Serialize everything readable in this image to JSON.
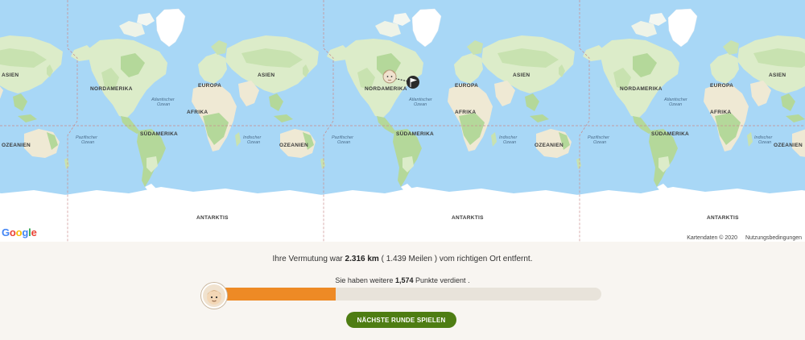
{
  "map": {
    "continents": {
      "north_america": "NORDAMERIKA",
      "south_america": "SÜDAMERIKA",
      "europe": "EUROPA",
      "africa": "AFRIKA",
      "asia": "ASIEN",
      "oceania": "OZEANIEN",
      "antarctica": "ANTARKTIS"
    },
    "oceans": {
      "atlantic_1": "Atlantischer",
      "atlantic_2": "Ozean",
      "pacific_1": "Pazifischer",
      "pacific_2": "Ozean",
      "indian_1": "Indischer",
      "indian_2": "Ozean"
    },
    "logo": "Google",
    "attribution": {
      "data": "Kartendaten © 2020",
      "terms": "Nutzungsbedingungen"
    },
    "colors": {
      "water": "#a8d7f6",
      "land": "#dcecc9",
      "forest": "#b4d89a",
      "ice": "#ffffff",
      "desert": "#efe9d4"
    },
    "icons": {
      "guess": "avatar-icon",
      "target": "flag-icon"
    }
  },
  "result": {
    "prefix": "Ihre Vermutung war",
    "distance_km": "2.316 km",
    "paren_open": "(",
    "distance_miles": "1.439 Meilen",
    "paren_close": ")",
    "suffix": "vom richtigen Ort entfernt."
  },
  "points": {
    "prefix": "Sie haben weitere",
    "value": "1,574",
    "suffix": "Punkte verdient",
    "period": "."
  },
  "progress": {
    "fraction": 0.3148,
    "color": "#ee8a25",
    "track": "#e8e3da"
  },
  "button": {
    "label": "NÄCHSTE RUNDE SPIELEN",
    "color": "#4e7d13"
  }
}
